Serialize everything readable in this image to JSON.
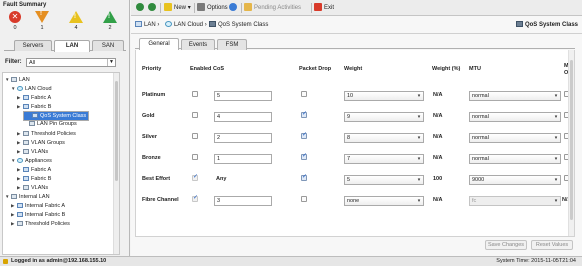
{
  "fault_summary": {
    "title": "Fault Summary",
    "items": [
      {
        "icon": "critical-icon",
        "count": "0",
        "color": "#d83a2a"
      },
      {
        "icon": "major-icon",
        "count": "1",
        "color": "#e58f22"
      },
      {
        "icon": "minor-icon",
        "count": "4",
        "color": "#e8c21e"
      },
      {
        "icon": "warning-icon",
        "count": "2",
        "color": "#32a048"
      }
    ]
  },
  "nav_tabs": [
    "Servers",
    "LAN",
    "SAN"
  ],
  "filter": {
    "label": "Filter:",
    "value": "All"
  },
  "tree": [
    {
      "label": "LAN"
    },
    {
      "label": "LAN Cloud"
    },
    {
      "label": "Fabric A"
    },
    {
      "label": "Fabric B"
    },
    {
      "label": "QoS System Class"
    },
    {
      "label": "LAN Pin Groups"
    },
    {
      "label": "Threshold Policies"
    },
    {
      "label": "VLAN Groups"
    },
    {
      "label": "VLANs"
    },
    {
      "label": "Appliances"
    },
    {
      "label": "Fabric A"
    },
    {
      "label": "Fabric B"
    },
    {
      "label": "VLANs"
    },
    {
      "label": "Internal LAN"
    },
    {
      "label": "Internal Fabric A"
    },
    {
      "label": "Internal Fabric B"
    },
    {
      "label": "Threshold Policies"
    }
  ],
  "toolbar": {
    "new": "New",
    "options": "Options",
    "pending": "Pending Activities",
    "exit": "Exit"
  },
  "breadcrumb": {
    "lan": "LAN",
    "lan_cloud": "LAN Cloud",
    "qos": "QoS System Class",
    "page_title": "QoS System Class"
  },
  "content_tabs": [
    "General",
    "Events",
    "FSM"
  ],
  "table": {
    "headers": {
      "priority": "Priority",
      "enabled": "Enabled",
      "cos": "CoS",
      "packet_drop": "Packet Drop",
      "weight": "Weight",
      "weight_pct": "Weight (%)",
      "mtu": "MTU",
      "multicast_l1": "Mul",
      "multicast_l2": "Opt"
    },
    "rows": [
      {
        "priority": "Platinum",
        "enabled": false,
        "cos": "5",
        "packet_drop": false,
        "weight": "10",
        "weight_pct": "N/A",
        "mtu": "normal"
      },
      {
        "priority": "Gold",
        "enabled": false,
        "cos": "4",
        "packet_drop": true,
        "weight": "9",
        "weight_pct": "N/A",
        "mtu": "normal"
      },
      {
        "priority": "Silver",
        "enabled": false,
        "cos": "2",
        "packet_drop": true,
        "weight": "8",
        "weight_pct": "N/A",
        "mtu": "normal"
      },
      {
        "priority": "Bronze",
        "enabled": false,
        "cos": "1",
        "packet_drop": true,
        "weight": "7",
        "weight_pct": "N/A",
        "mtu": "normal"
      },
      {
        "priority": "Best Effort",
        "enabled": true,
        "cos": "Any",
        "packet_drop": true,
        "weight": "5",
        "weight_pct": "100",
        "mtu": "9000"
      },
      {
        "priority": "Fibre Channel",
        "enabled": true,
        "cos": "3",
        "packet_drop": false,
        "weight": "none",
        "weight_pct": "N/A",
        "mtu": "fc",
        "multicast": "N/A"
      }
    ]
  },
  "buttons": {
    "save": "Save Changes",
    "reset": "Reset Values"
  },
  "status": {
    "login": "Logged in as admin@192.168.155.10",
    "time": "System Time: 2015-11-05T21:04"
  }
}
